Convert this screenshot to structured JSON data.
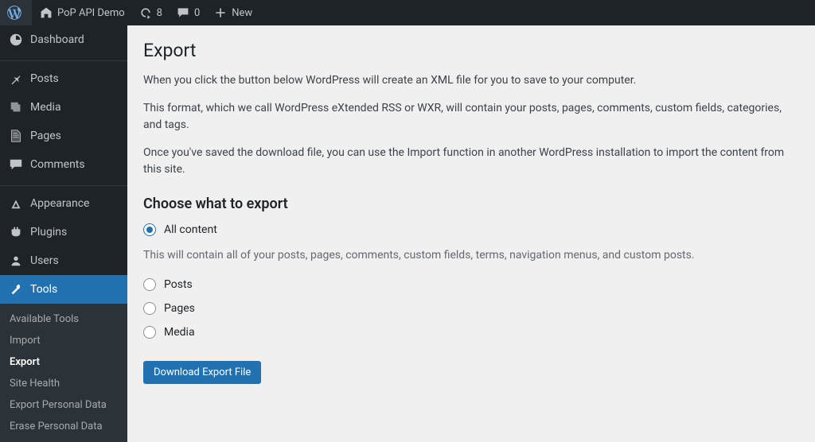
{
  "adminbar": {
    "site_title": "PoP API Demo",
    "updates_count": "8",
    "comments_count": "0",
    "new_label": "New"
  },
  "sidebar": {
    "items": [
      {
        "label": "Dashboard"
      },
      {
        "label": "Posts"
      },
      {
        "label": "Media"
      },
      {
        "label": "Pages"
      },
      {
        "label": "Comments"
      },
      {
        "label": "Appearance"
      },
      {
        "label": "Plugins"
      },
      {
        "label": "Users"
      },
      {
        "label": "Tools"
      }
    ],
    "submenu": [
      {
        "label": "Available Tools"
      },
      {
        "label": "Import"
      },
      {
        "label": "Export"
      },
      {
        "label": "Site Health"
      },
      {
        "label": "Export Personal Data"
      },
      {
        "label": "Erase Personal Data"
      }
    ]
  },
  "page": {
    "title": "Export",
    "para1": "When you click the button below WordPress will create an XML file for you to save to your computer.",
    "para2": "This format, which we call WordPress eXtended RSS or WXR, will contain your posts, pages, comments, custom fields, categories, and tags.",
    "para3": "Once you've saved the download file, you can use the Import function in another WordPress installation to import the content from this site.",
    "choose_heading": "Choose what to export",
    "all_label": "All content",
    "all_desc": "This will contain all of your posts, pages, comments, custom fields, terms, navigation menus, and custom posts.",
    "posts_label": "Posts",
    "pages_label": "Pages",
    "media_label": "Media",
    "submit": "Download Export File"
  }
}
